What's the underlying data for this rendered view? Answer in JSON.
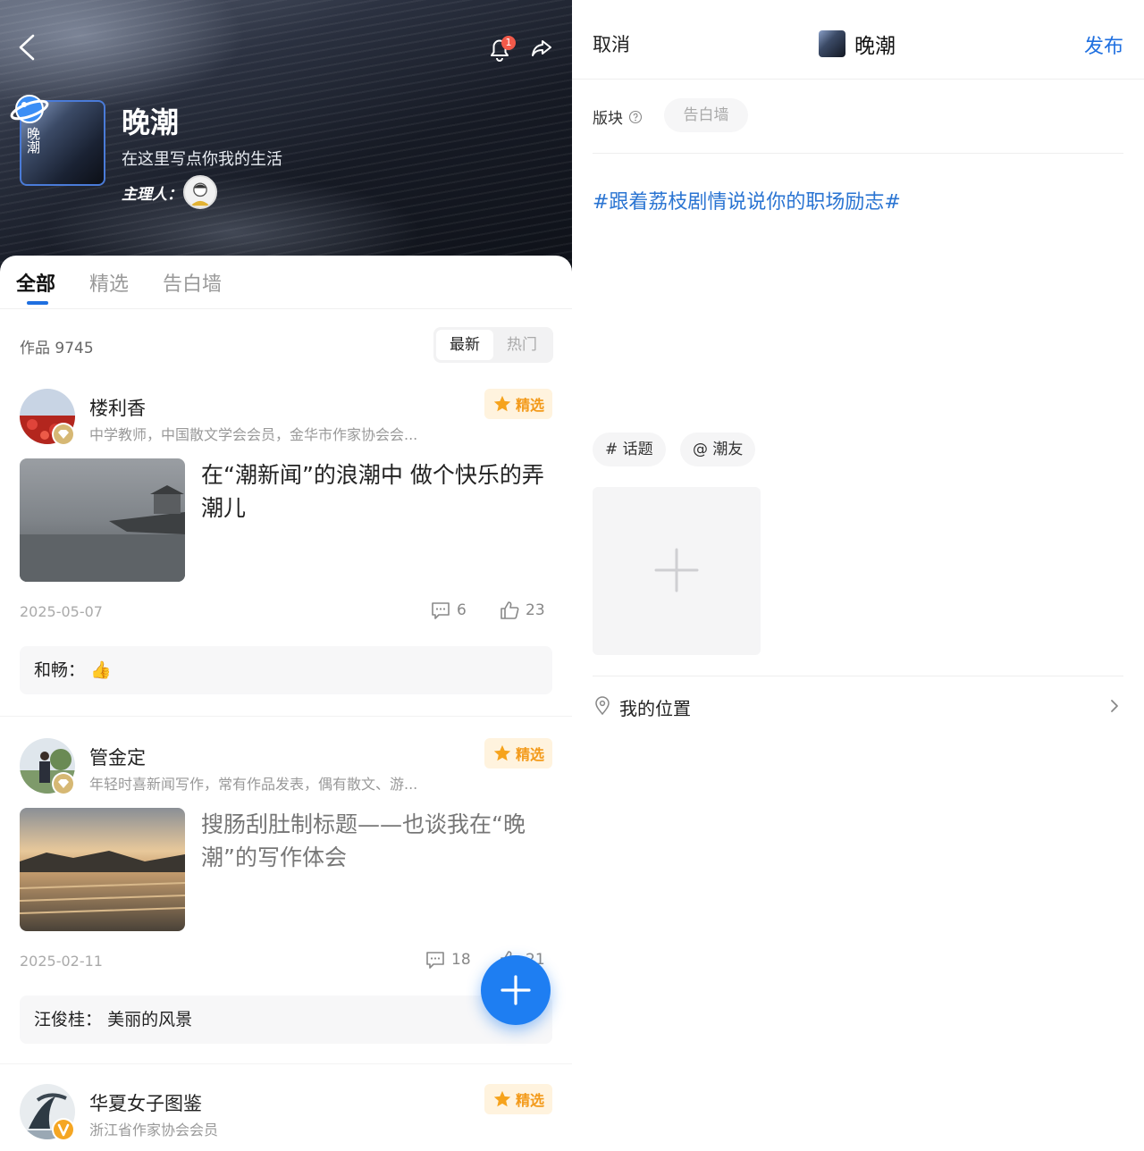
{
  "left": {
    "header": {
      "notification_count": "1",
      "circle_title": "晚潮",
      "circle_cover_text": "晚潮",
      "circle_description": "在这里写点你我的生活",
      "host_label": "主理人："
    },
    "tabs": [
      "全部",
      "精选",
      "告白墙"
    ],
    "active_tab": "全部",
    "works_count_label": "作品 9745",
    "sort": {
      "newest": "最新",
      "hot": "热门",
      "selected": "最新"
    },
    "featured_label": "精选",
    "posts": [
      {
        "author": "楼利香",
        "bio": "中学教师，中国散文学会会员，金华市作家协会会...",
        "title": "在“潮新闻”的浪潮中 做个快乐的弄潮儿",
        "date": "2025-05-07",
        "comments": "6",
        "likes": "23",
        "comment_user": "和畅：",
        "comment_text": "👍"
      },
      {
        "author": "管金定",
        "bio": "年轻时喜新闻写作，常有作品发表，偶有散文、游...",
        "title": "搜肠刮肚制标题——也谈我在“晚潮”的写作体会",
        "date": "2025-02-11",
        "comments": "18",
        "likes": "21",
        "comment_user": "汪俊桂：",
        "comment_text": "美丽的风景"
      },
      {
        "author": "华夏女子图鉴",
        "bio": "浙江省作家协会会员"
      }
    ]
  },
  "right": {
    "cancel_label": "取消",
    "title": "晚潮",
    "publish_label": "发布",
    "section_label": "版块",
    "section_value": "告白墙",
    "topic_text": "#跟着荔枝剧情说说你的职场励志#",
    "topic_button": "# 话题",
    "mention_button": "@ 潮友",
    "location_label": "我的位置"
  },
  "colors": {
    "accent": "#1e6fe0",
    "featured": "#f39a1a",
    "topic": "#2a74d2"
  }
}
